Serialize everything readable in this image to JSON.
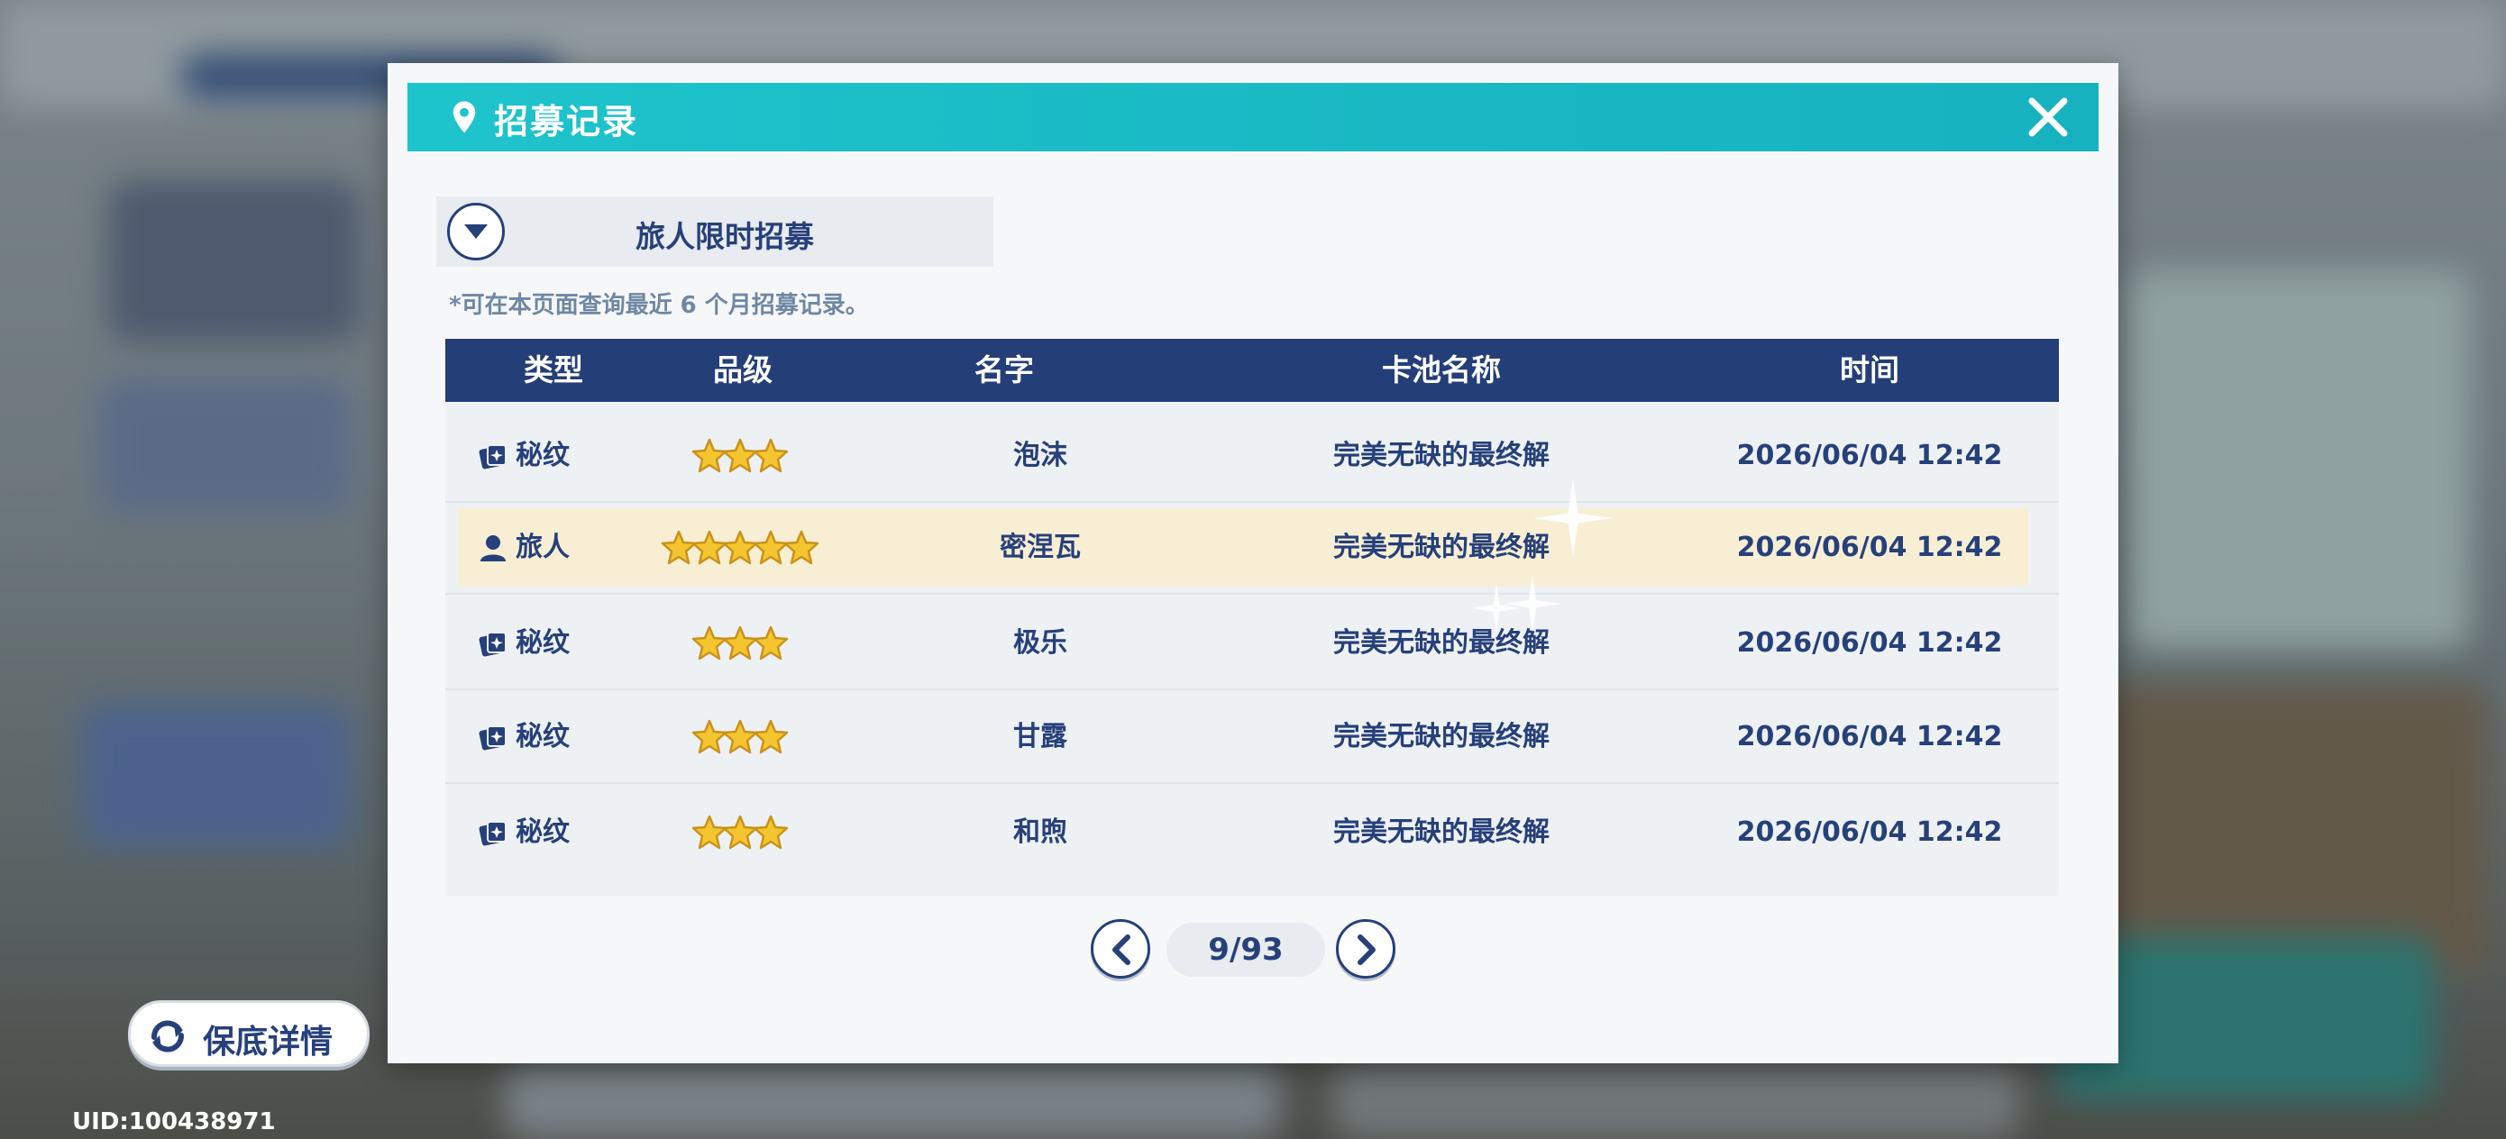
{
  "modal": {
    "title": "招募记录",
    "pool_selector": "旅人限时招募",
    "note": "*可在本页面查询最近 6 个月招募记录。"
  },
  "table": {
    "headers": [
      "类型",
      "品级",
      "名字",
      "卡池名称",
      "时间"
    ],
    "rows": [
      {
        "type": "秘纹",
        "type_icon": "card-icon",
        "stars": 3,
        "name": "泡沫",
        "pool": "完美无缺的最终解",
        "time": "2026/06/04 12:42",
        "highlight": false
      },
      {
        "type": "旅人",
        "type_icon": "person-icon",
        "stars": 5,
        "name": "密涅瓦",
        "pool": "完美无缺的最终解",
        "time": "2026/06/04 12:42",
        "highlight": true
      },
      {
        "type": "秘纹",
        "type_icon": "card-icon",
        "stars": 3,
        "name": "极乐",
        "pool": "完美无缺的最终解",
        "time": "2026/06/04 12:42",
        "highlight": false
      },
      {
        "type": "秘纹",
        "type_icon": "card-icon",
        "stars": 3,
        "name": "甘露",
        "pool": "完美无缺的最终解",
        "time": "2026/06/04 12:42",
        "highlight": false
      },
      {
        "type": "秘纹",
        "type_icon": "card-icon",
        "stars": 3,
        "name": "和煦",
        "pool": "完美无缺的最终解",
        "time": "2026/06/04 12:42",
        "highlight": false
      }
    ]
  },
  "pagination": {
    "label": "9/93",
    "current": 9,
    "total": 93
  },
  "guarantee_button": "保底详情",
  "uid": "UID:100438971",
  "colors": {
    "accent": "#1ec4cc",
    "navy": "#243e78",
    "highlight_row": "#f8eed3",
    "star": "#f5c530"
  }
}
